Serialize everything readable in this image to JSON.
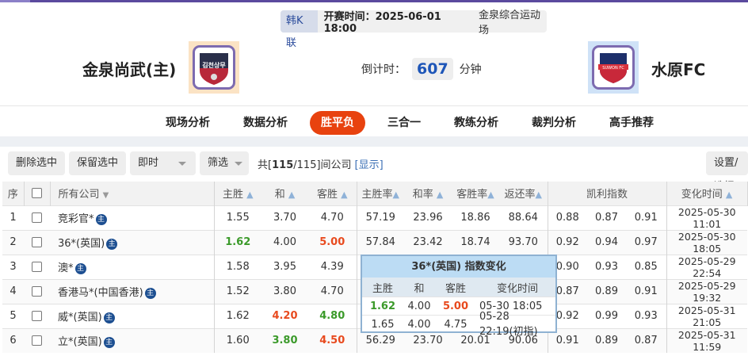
{
  "match": {
    "league": "韩K联",
    "kickoff_label": "开赛时间：2025-06-01 18:00",
    "venue": "金泉综合运动场",
    "countdown_label": "倒计时：",
    "countdown_value": "607",
    "countdown_unit": "分钟"
  },
  "home": {
    "name": "金泉尚武(主)",
    "logo_text": "김천상무"
  },
  "away": {
    "name": "水原FC",
    "logo_text": "SUWON FC"
  },
  "nav": [
    "现场分析",
    "数据分析",
    "胜平负",
    "三合一",
    "教练分析",
    "裁判分析",
    "高手推荐"
  ],
  "nav_active": "胜平负",
  "toolbar": {
    "delete": "删除选中",
    "keep": "保留选中",
    "mode": "即时",
    "filter": "筛选",
    "count_prefix": "共[",
    "count_bold": "115",
    "count_suffix": "/115]间公司",
    "show": "[显示]",
    "settings": "设置/选择"
  },
  "headers": {
    "seq": "序",
    "company": "所有公司",
    "home": "主胜",
    "draw": "和",
    "away": "客胜",
    "home_rate": "主胜率",
    "draw_rate": "和率",
    "away_rate": "客胜率",
    "return_rate": "返还率",
    "kelly": "凯利指数",
    "time": "变化时间"
  },
  "rows": [
    {
      "seq": "1",
      "company": "竞彩官*",
      "home": "1.55",
      "draw": "3.70",
      "away": "4.70",
      "hr": "57.19",
      "dr": "23.96",
      "ar": "18.86",
      "rr": "88.64",
      "k1": "0.88",
      "k2": "0.87",
      "k3": "0.91",
      "time": "2025-05-30 11:01",
      "hc": "",
      "dc": "",
      "ac": ""
    },
    {
      "seq": "2",
      "company": "36*(英国)",
      "home": "1.62",
      "draw": "4.00",
      "away": "5.00",
      "hr": "57.84",
      "dr": "23.42",
      "ar": "18.74",
      "rr": "93.70",
      "k1": "0.92",
      "k2": "0.94",
      "k3": "0.97",
      "time": "2025-05-30 18:05",
      "hc": "g",
      "dc": "",
      "ac": "r"
    },
    {
      "seq": "3",
      "company": "澳*",
      "home": "1.58",
      "draw": "3.95",
      "away": "4.39",
      "hr": "",
      "dr": "",
      "ar": "",
      "rr": "",
      "k1": "0.90",
      "k2": "0.93",
      "k3": "0.85",
      "time": "2025-05-29 22:54",
      "hc": "",
      "dc": "",
      "ac": ""
    },
    {
      "seq": "4",
      "company": "香港马*(中国香港)",
      "home": "1.52",
      "draw": "3.80",
      "away": "4.70",
      "hr": "",
      "dr": "",
      "ar": "",
      "rr": "",
      "k1": "0.87",
      "k2": "0.89",
      "k3": "0.91",
      "time": "2025-05-29 19:32",
      "hc": "",
      "dc": "",
      "ac": ""
    },
    {
      "seq": "5",
      "company": "威*(英国)",
      "home": "1.62",
      "draw": "4.20",
      "away": "4.80",
      "hr": "",
      "dr": "",
      "ar": "",
      "rr": "",
      "k1": "0.92",
      "k2": "0.99",
      "k3": "0.93",
      "time": "2025-05-31 21:05",
      "hc": "",
      "dc": "r",
      "ac": "g"
    },
    {
      "seq": "6",
      "company": "立*(英国)",
      "home": "1.60",
      "draw": "3.80",
      "away": "4.50",
      "hr": "56.29",
      "dr": "23.70",
      "ar": "20.01",
      "rr": "90.06",
      "k1": "0.91",
      "k2": "0.89",
      "k3": "0.87",
      "time": "2025-05-31 11:59",
      "hc": "",
      "dc": "g",
      "ac": "r"
    }
  ],
  "badge": "主",
  "popup": {
    "title": "36*(英国) 指数变化",
    "headers": [
      "主胜",
      "和",
      "客胜",
      "变化时间"
    ],
    "rows": [
      [
        "1.62",
        "4.00",
        "5.00",
        "05-30 18:05"
      ],
      [
        "1.65",
        "4.00",
        "4.75",
        "05-28 22:19(初指)"
      ]
    ]
  },
  "colors": {
    "accent": "#e8420f",
    "up": "#3b9a2a",
    "down": "#e84a1e",
    "brand": "#5b4a9e"
  }
}
